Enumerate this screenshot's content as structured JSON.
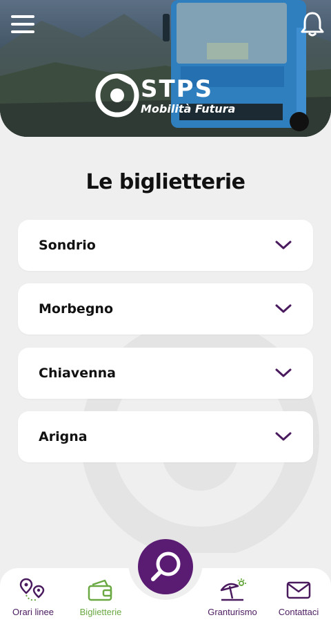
{
  "header": {
    "logo_word": "STPS",
    "logo_tagline": "Mobilità Futura",
    "menu_icon": "hamburger-menu-icon",
    "notification_icon": "bell-icon"
  },
  "page": {
    "title": "Le biglietterie"
  },
  "offices": [
    {
      "name": "Sondrio"
    },
    {
      "name": "Morbegno"
    },
    {
      "name": "Chiavenna"
    },
    {
      "name": "Arigna"
    }
  ],
  "search_button": {
    "icon": "search-icon"
  },
  "bottom_nav": [
    {
      "label": "Orari linee",
      "icon": "route-pin-icon",
      "active": false
    },
    {
      "label": "Biglietterie",
      "icon": "ticket-wallet-icon",
      "active": true
    },
    {
      "label": "Granturismo",
      "icon": "beach-umbrella-icon",
      "active": false
    },
    {
      "label": "Contattaci",
      "icon": "envelope-icon",
      "active": false
    }
  ],
  "colors": {
    "brand_purple": "#5a1b72",
    "active_green": "#6aa842",
    "background": "#efefef",
    "card": "#ffffff"
  }
}
